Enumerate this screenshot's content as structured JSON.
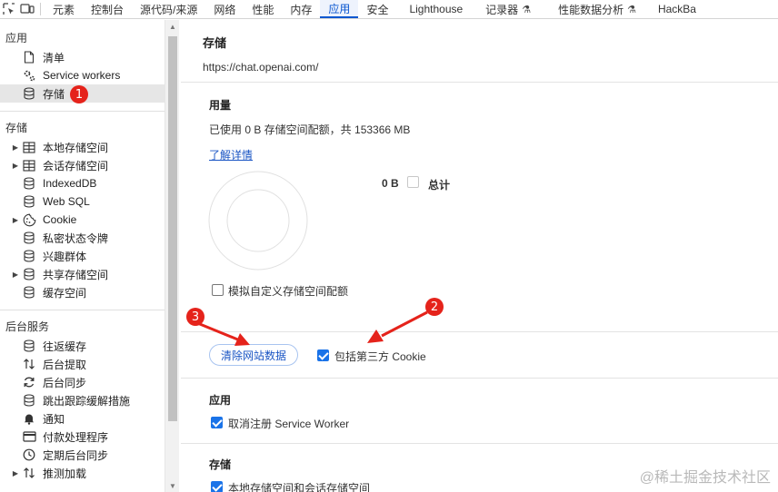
{
  "tabs": [
    {
      "label": "元素",
      "active": false
    },
    {
      "label": "控制台",
      "active": false
    },
    {
      "label": "源代码/来源",
      "active": false
    },
    {
      "label": "网络",
      "active": false
    },
    {
      "label": "性能",
      "active": false
    },
    {
      "label": "内存",
      "active": false
    },
    {
      "label": "应用",
      "active": true
    },
    {
      "label": "安全",
      "active": false
    },
    {
      "label": "Lighthouse",
      "active": false
    },
    {
      "label": "记录器",
      "active": false,
      "icon": "flask-icon"
    },
    {
      "label": "性能数据分析",
      "active": false,
      "icon": "flask-icon"
    },
    {
      "label": "HackBa",
      "active": false
    }
  ],
  "sidebar": {
    "app_title": "应用",
    "app_items": [
      {
        "label": "清单",
        "icon": "file-icon"
      },
      {
        "label": "Service workers",
        "icon": "gears-icon"
      },
      {
        "label": "存储",
        "icon": "database-icon",
        "selected": true
      }
    ],
    "storage_title": "存储",
    "storage_items": [
      {
        "label": "本地存储空间",
        "icon": "table-icon",
        "expandable": true
      },
      {
        "label": "会话存储空间",
        "icon": "table-icon",
        "expandable": true
      },
      {
        "label": "IndexedDB",
        "icon": "database-icon",
        "expandable": false
      },
      {
        "label": "Web SQL",
        "icon": "database-icon",
        "expandable": false
      },
      {
        "label": "Cookie",
        "icon": "cookie-icon",
        "expandable": true
      },
      {
        "label": "私密状态令牌",
        "icon": "database-icon",
        "expandable": false
      },
      {
        "label": "兴趣群体",
        "icon": "database-icon",
        "expandable": false
      },
      {
        "label": "共享存储空间",
        "icon": "database-icon",
        "expandable": true
      },
      {
        "label": "缓存空间",
        "icon": "database-icon",
        "expandable": false
      }
    ],
    "bg_title": "后台服务",
    "bg_items": [
      {
        "label": "往返缓存",
        "icon": "database-icon",
        "expandable": false
      },
      {
        "label": "后台提取",
        "icon": "updown-arrows-icon",
        "expandable": false
      },
      {
        "label": "后台同步",
        "icon": "sync-icon",
        "expandable": false
      },
      {
        "label": "跳出跟踪缓解措施",
        "icon": "database-icon",
        "expandable": false
      },
      {
        "label": "通知",
        "icon": "bell-icon",
        "expandable": false
      },
      {
        "label": "付款处理程序",
        "icon": "card-icon",
        "expandable": false
      },
      {
        "label": "定期后台同步",
        "icon": "clock-icon",
        "expandable": false
      },
      {
        "label": "推测加载",
        "icon": "updown-arrows-icon",
        "expandable": true
      }
    ]
  },
  "main": {
    "title": "存储",
    "origin": "https://chat.openai.com/",
    "usage": {
      "heading": "用量",
      "summary": "已使用 0 B 存储空间配额，共 153366 MB",
      "learn_more": "了解详情",
      "legend_value": "0 B",
      "legend_label": "总计",
      "simulate_label": "模拟自定义存储空间配额",
      "simulate_checked": false
    },
    "clear_button": "清除网站数据",
    "include_cookie_label": "包括第三方 Cookie",
    "include_cookie_checked": true,
    "app_section": {
      "heading": "应用",
      "unregister_label": "取消注册 Service Worker",
      "unregister_checked": true
    },
    "storage_section": {
      "heading": "存储",
      "local_session_label": "本地存储空间和会话存储空间",
      "local_session_checked": true
    }
  },
  "annotations": {
    "badge1": "1",
    "badge2": "2",
    "badge3": "3",
    "color": "#e5231b"
  },
  "watermark": "@稀土掘金技术社区"
}
